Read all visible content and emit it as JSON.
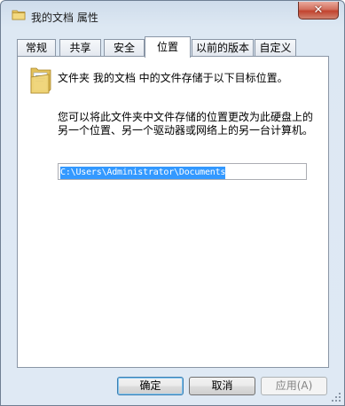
{
  "window": {
    "title": "我的文档 属性",
    "close_label": "✕"
  },
  "tabs": [
    {
      "label": "常规",
      "active": false
    },
    {
      "label": "共享",
      "active": false
    },
    {
      "label": "安全",
      "active": false
    },
    {
      "label": "位置",
      "active": true
    },
    {
      "label": "以前的版本",
      "active": false
    },
    {
      "label": "自定义",
      "active": false
    }
  ],
  "location": {
    "folder_icon": "folder-icon",
    "description": "文件夹 我的文档 中的文件存储于以下目标位置。",
    "info": "您可以将此文件夹中文件存储的位置更改为此硬盘上的另一个位置、另一个驱动器或网络上的另一台计算机。",
    "path_value": "C:\\Users\\Administrator\\Documents"
  },
  "buttons": {
    "ok": "确定",
    "cancel": "取消",
    "apply": "应用(A)"
  }
}
